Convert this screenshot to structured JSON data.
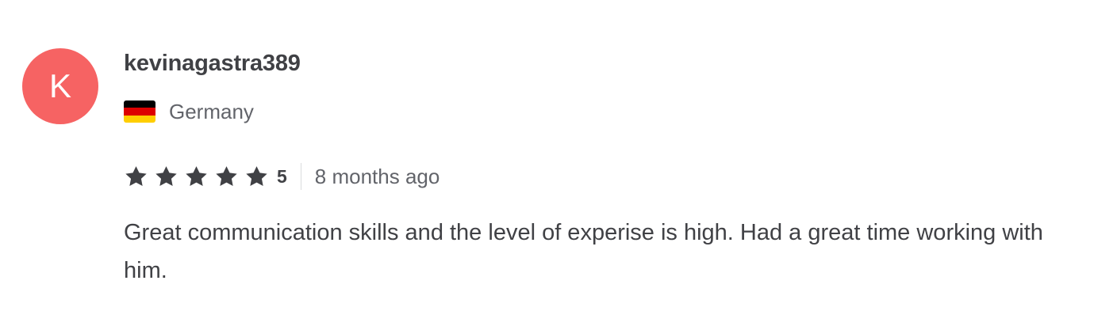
{
  "review": {
    "avatar_letter": "K",
    "avatar_color": "#f66363",
    "username": "kevinagastra389",
    "country": {
      "name": "Germany",
      "flag_icon": "germany-flag-icon",
      "flag_colors": [
        "#000000",
        "#dd0000",
        "#ffce00"
      ]
    },
    "rating": {
      "stars": 5,
      "max_stars": 5,
      "score_label": "5",
      "star_icon": "star-icon",
      "star_color": "#404145"
    },
    "time_ago": "8 months ago",
    "text": "Great communication skills and the level of experise is high. Had a great time working with him."
  }
}
